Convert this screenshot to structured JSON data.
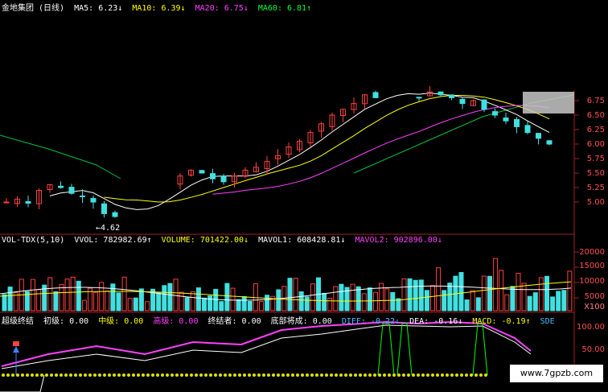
{
  "price_header": {
    "title": "金地集团 (日线)",
    "ma5": "MA5: 6.23↓",
    "ma10": "MA10: 6.39↓",
    "ma20": "MA20: 6.75↓",
    "ma60": "MA60: 6.81↑",
    "low_label": "←4.62"
  },
  "price_axis": [
    "6.75",
    "6.50",
    "6.25",
    "6.00",
    "5.75",
    "5.50",
    "5.25",
    "5.00"
  ],
  "volume_header": {
    "indicator": "VOL-TDX(5,10)",
    "vvol": "VVOL: 782982.69↑",
    "volume": "VOLUME: 701422.00↓",
    "mavol1": "MAVOL1: 608428.81↓",
    "mavol2": "MAVOL2: 902896.00↓"
  },
  "volume_axis": [
    "20000",
    "15000",
    "10000",
    "5000",
    "X100"
  ],
  "indicator_header": {
    "name": "超级终结",
    "initial": "初级: 0.00",
    "middle": "中级: 0.00",
    "high": "高级: 0.00",
    "terminator": "终结者: 0.00",
    "bottom": "底部将成: 0.00",
    "diff": "DIFF: -0.22↓",
    "dea": "DEA: -0.16↓",
    "macd": "MACD: -0.19↑",
    "tail": "SDE"
  },
  "indicator_axis": [
    "100.00",
    "50.00"
  ],
  "watermark": "www.7gpzb.com",
  "colors": {
    "up": "#ff4040",
    "down": "#40e0e0",
    "ma5": "#ffffff",
    "ma10": "#ffff00",
    "ma20": "#ff40ff",
    "ma60": "#00c040"
  },
  "chart_data": {
    "type": "candlestick",
    "ylim_price": [
      4.62,
      6.81
    ],
    "volume_ylim": [
      0,
      20000
    ],
    "indicator_ylim": [
      0,
      100
    ]
  }
}
